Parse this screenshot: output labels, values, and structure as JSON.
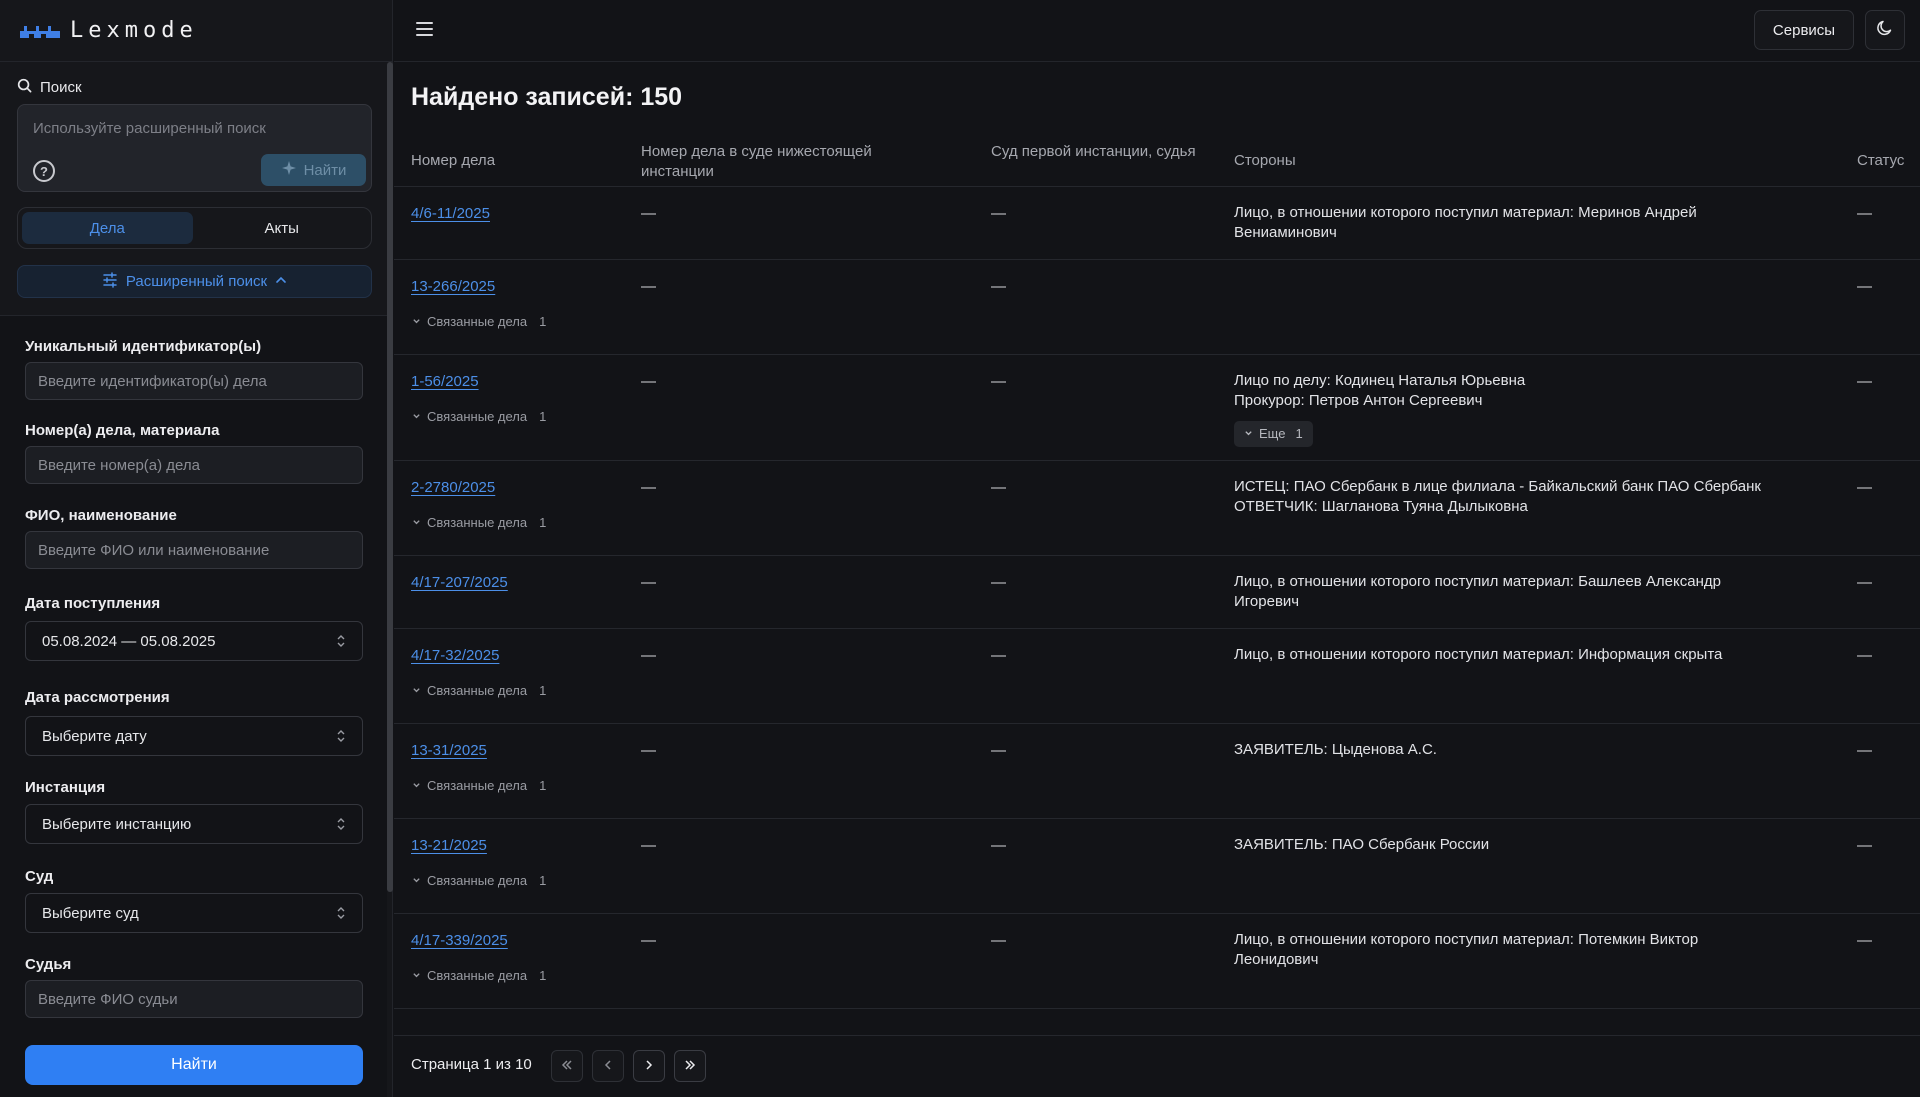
{
  "app": {
    "brand": "Lexmode"
  },
  "sidebar": {
    "search_label": "Поиск",
    "search_placeholder": "Используйте расширенный поиск",
    "find_ai_label": "Найти",
    "tabs": [
      {
        "label": "Дела",
        "active": true
      },
      {
        "label": "Акты",
        "active": false
      }
    ],
    "advanced_toggle_label": "Расширенный поиск",
    "filters": {
      "uid_label": "Уникальный идентификатор(ы)",
      "uid_placeholder": "Введите идентификатор(ы) дела",
      "case_number_label": "Номер(а) дела, материала",
      "case_number_placeholder": "Введите номер(а) дела",
      "name_label": "ФИО, наименование",
      "name_placeholder": "Введите ФИО или наименование",
      "received_date_label": "Дата поступления",
      "received_date_value": "05.08.2024 — 05.08.2025",
      "review_date_label": "Дата рассмотрения",
      "review_date_value": "Выберите дату",
      "instance_label": "Инстанция",
      "instance_value": "Выберите инстанцию",
      "court_label": "Суд",
      "court_value": "Выберите суд",
      "judge_label": "Судья",
      "judge_placeholder": "Введите ФИО судьи"
    },
    "submit_label": "Найти"
  },
  "topbar": {
    "services_label": "Сервисы"
  },
  "results": {
    "title": "Найдено записей: 150",
    "columns": {
      "case_number": "Номер дела",
      "lower_court_number": "Номер дела в суде нижестоящей инстанции",
      "first_instance": "Суд первой инстанции, судья",
      "parties": "Стороны",
      "status": "Статус"
    },
    "related_label": "Связанные дела",
    "more_label": "Еще",
    "rows": [
      {
        "number": "4/6-11/2025",
        "lower": "—",
        "first": "—",
        "status": "—",
        "parties": [
          "Лицо, в отношении которого поступил материал: Меринов Андрей",
          "Вениаминович"
        ]
      },
      {
        "number": "13-266/2025",
        "lower": "—",
        "first": "—",
        "status": "—",
        "related_count": "1"
      },
      {
        "number": "1-56/2025",
        "lower": "—",
        "first": "—",
        "status": "—",
        "related_count": "1",
        "parties": [
          "Лицо по делу: Кодинец Наталья Юрьевна",
          "Прокурор: Петров Антон Сергеевич"
        ],
        "more_count": "1"
      },
      {
        "number": "2-2780/2025",
        "lower": "—",
        "first": "—",
        "status": "—",
        "related_count": "1",
        "parties": [
          "ИСТЕЦ: ПАО Сбербанк в лице филиала - Байкальский банк ПАО Сбербанк",
          "ОТВЕТЧИК: Шагланова Туяна Дылыковна"
        ]
      },
      {
        "number": "4/17-207/2025",
        "lower": "—",
        "first": "—",
        "status": "—",
        "parties": [
          "Лицо, в отношении которого поступил материал: Башлеев Александр",
          "Игоревич"
        ]
      },
      {
        "number": "4/17-32/2025",
        "lower": "—",
        "first": "—",
        "status": "—",
        "related_count": "1",
        "parties": [
          "Лицо, в отношении которого поступил материал: Информация скрыта"
        ]
      },
      {
        "number": "13-31/2025",
        "lower": "—",
        "first": "—",
        "status": "—",
        "related_count": "1",
        "parties": [
          "ЗАЯВИТЕЛЬ: Цыденова А.С."
        ]
      },
      {
        "number": "13-21/2025",
        "lower": "—",
        "first": "—",
        "status": "—",
        "related_count": "1",
        "parties": [
          "ЗАЯВИТЕЛЬ: ПАО Сбербанк России"
        ]
      },
      {
        "number": "4/17-339/2025",
        "lower": "—",
        "first": "—",
        "status": "—",
        "related_count": "1",
        "parties": [
          "Лицо, в отношении которого поступил материал: Потемкин Виктор",
          "Леонидович"
        ]
      }
    ]
  },
  "pager": {
    "text": "Страница 1 из 10"
  },
  "colors": {
    "accent": "#2f7ff3",
    "link": "#4c8fe8",
    "background": "#121317"
  }
}
